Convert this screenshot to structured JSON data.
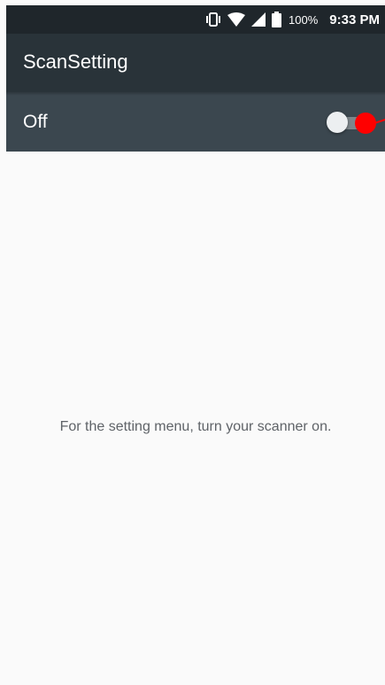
{
  "status_bar": {
    "battery_percent": "100%",
    "time": "9:33 PM",
    "icons": [
      "vibrate-icon",
      "wifi-icon",
      "cell-signal-icon",
      "battery-icon"
    ]
  },
  "app_bar": {
    "title": "ScanSetting"
  },
  "scanner_toggle": {
    "label": "Off",
    "state": "off"
  },
  "content": {
    "message": "For the setting menu, turn your scanner on."
  },
  "colors": {
    "status_bar_bg": "#1f262b",
    "app_bar_bg": "#293339",
    "toggle_bar_bg": "#3b474f",
    "content_bg": "#fafafa",
    "marker": "#ff0000"
  }
}
